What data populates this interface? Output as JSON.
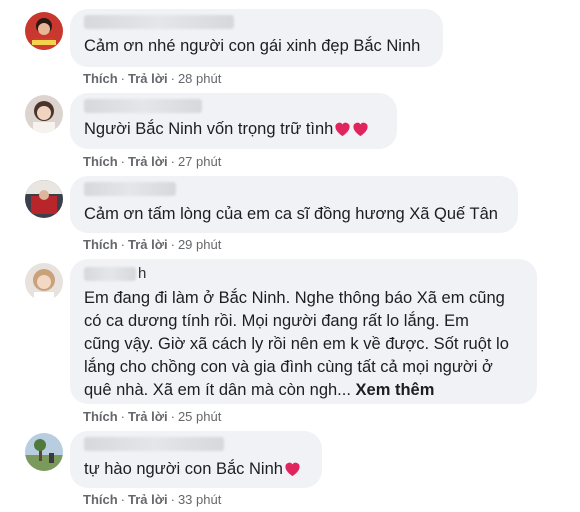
{
  "comments": [
    {
      "text": "Cảm ơn nhé người con gái xinh đẹp Bắc Ninh",
      "like_label": "Thích",
      "reply_label": "Trả lời",
      "time": "28 phút",
      "hearts": 0
    },
    {
      "text": "Người Bắc Ninh vốn trọng trữ tình",
      "like_label": "Thích",
      "reply_label": "Trả lời",
      "time": "27 phút",
      "hearts": 2
    },
    {
      "text": "Cảm ơn tấm lòng của em ca sĩ đồng hương Xã Quế Tân",
      "like_label": "Thích",
      "reply_label": "Trả lời",
      "time": "29 phút",
      "hearts": 0
    },
    {
      "name_suffix": "h",
      "lines": [
        "Em đang đi làm ở Bắc Ninh. Nghe thông báo Xã em cũng",
        "có ca dương tính rồi. Mọi người đang rất lo lắng. Em",
        "cũng vậy. Giờ xã cách ly rồi nên em k về được. Sốt ruột lo",
        "lắng cho chồng con và gia đình cùng tất cả mọi người ở",
        "quê nhà. Xã em ít dân mà còn ngh..."
      ],
      "see_more": "Xem thêm",
      "like_label": "Thích",
      "reply_label": "Trả lời",
      "time": "25 phút",
      "hearts": 0
    },
    {
      "text": "tự hào người con Bắc Ninh",
      "like_label": "Thích",
      "reply_label": "Trả lời",
      "time": "33 phút",
      "hearts": 1
    }
  ],
  "colors": {
    "bubble": "#f0f2f5",
    "text": "#1c1e21",
    "meta": "#65676b",
    "heart": "#e0245e"
  }
}
